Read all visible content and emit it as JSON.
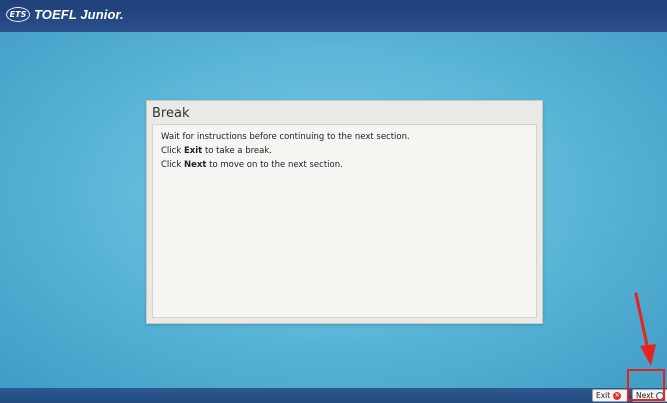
{
  "header": {
    "logo_badge": "ETS",
    "brand_name": "TOEFL Junior."
  },
  "dialog": {
    "title": "Break",
    "lines": [
      {
        "text": "Wait for instructions before continuing to the next section."
      },
      {
        "prefix": "Click ",
        "bold": "Exit",
        "suffix": " to take a break."
      },
      {
        "prefix": "Click ",
        "bold": "Next",
        "suffix": " to move on to the next section."
      }
    ]
  },
  "footer": {
    "exit_label": "Exit",
    "next_label": "Next"
  },
  "icons": {
    "exit": "close-circle-icon",
    "next": "arrow-right-icon"
  },
  "colors": {
    "header": "#1f3f78",
    "stage": "#58b4d6",
    "annotation": "#e8231f",
    "exit_icon": "#e2342b"
  }
}
